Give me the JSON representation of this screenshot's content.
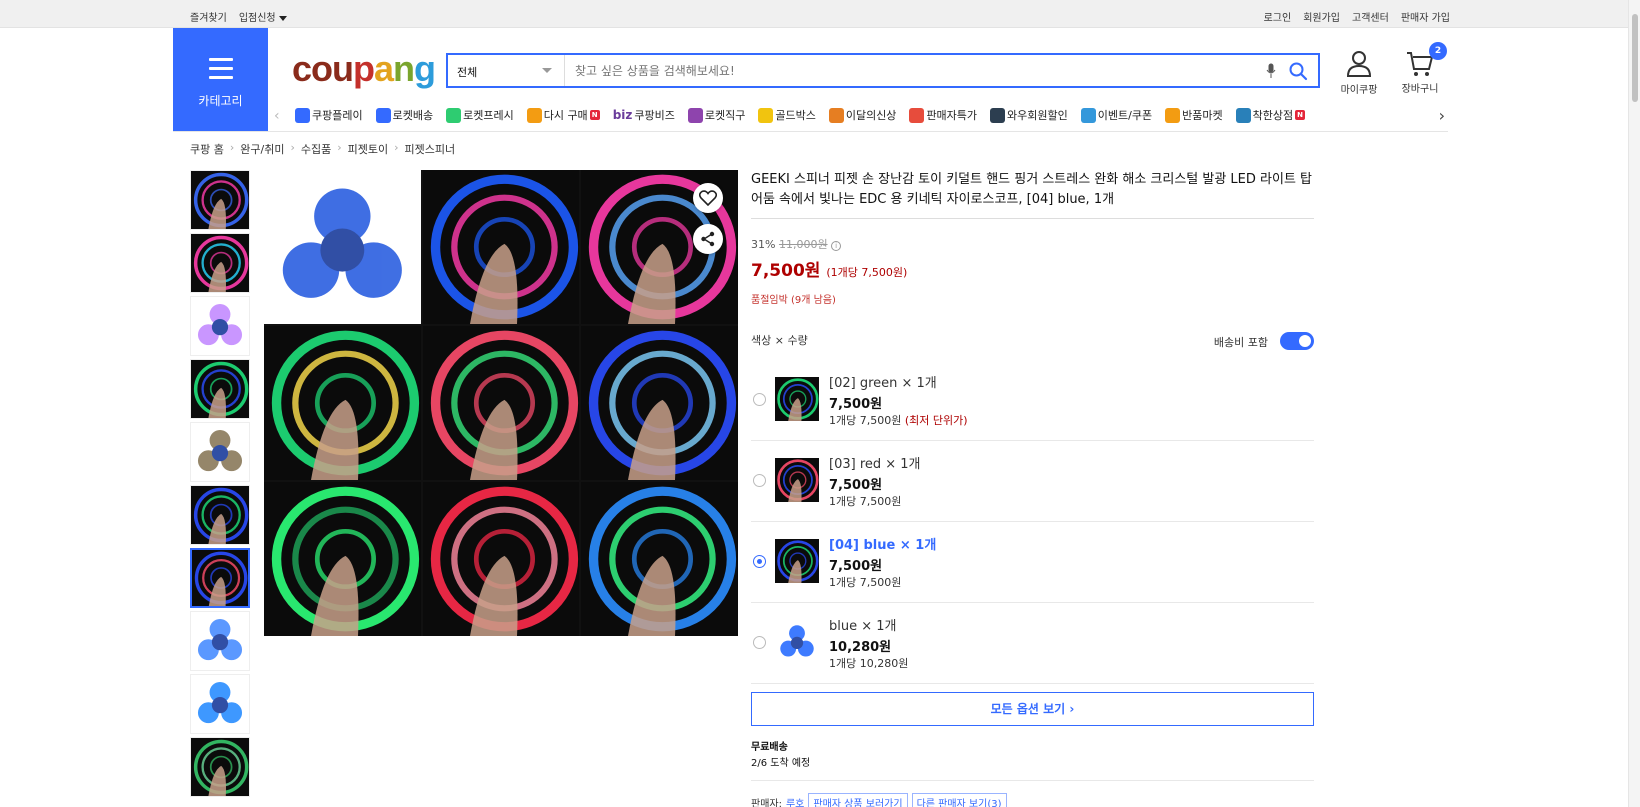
{
  "topbar": {
    "left": [
      "즐겨찾기",
      "입점신청"
    ],
    "right": [
      "로그인",
      "회원가입",
      "고객센터",
      "판매자 가입"
    ]
  },
  "category_label": "카테고리",
  "logo": {
    "text": [
      "cou",
      "p",
      "a",
      "n",
      "g"
    ]
  },
  "search": {
    "category": "전체",
    "placeholder": "찾고 싶은 상품을 검색해보세요!"
  },
  "header": {
    "my": "마이쿠팡",
    "cart": "장바구니",
    "cart_count": "2"
  },
  "nav": [
    {
      "label": "쿠팡플레이",
      "color": "#346aff",
      "icon": "play-icon"
    },
    {
      "label": "로켓배송",
      "color": "#346aff",
      "icon": "rocket-icon"
    },
    {
      "label": "로켓프레시",
      "color": "#2ecc71",
      "icon": "rocket-fresh-icon"
    },
    {
      "label": "다시 구매",
      "color": "#f39c12",
      "icon": "rebuy-icon",
      "badge": "N"
    },
    {
      "label": "쿠팡비즈",
      "color": "#6a3c9b",
      "icon": "biz-icon",
      "prefix": "biz"
    },
    {
      "label": "로켓직구",
      "color": "#8e44ad",
      "icon": "global-icon"
    },
    {
      "label": "골드박스",
      "color": "#f1c40f",
      "icon": "goldbox-icon"
    },
    {
      "label": "이달의신상",
      "color": "#e67e22",
      "icon": "new-icon"
    },
    {
      "label": "판매자특가",
      "color": "#e74c3c",
      "icon": "sale-icon"
    },
    {
      "label": "와우회원할인",
      "color": "#2c3e50",
      "icon": "wow-icon"
    },
    {
      "label": "이벤트/쿠폰",
      "color": "#3498db",
      "icon": "coupon-icon"
    },
    {
      "label": "반품마켓",
      "color": "#f39c12",
      "icon": "return-icon"
    },
    {
      "label": "착한상점",
      "color": "#2980b9",
      "icon": "store-icon",
      "badge": "N"
    }
  ],
  "breadcrumb": [
    "쿠팡 홈",
    "완구/취미",
    "수집품",
    "피젯토이",
    "피젯스피너"
  ],
  "product": {
    "title": "GEEKI 스피너 피젯 손 장난감 토이 키덜트 핸드 핑거 스트레스 완화 해소 크리스털 발광 LED 라이트 탑 어둠 속에서 빛나는 EDC 용 키네틱 자이로스코프, [04] blue, 1개",
    "discount": "31%",
    "original_price": "11,000원",
    "price": "7,500원",
    "unit_price": "(1개당 7,500원)",
    "stock": "품절임박 (9개 남음)",
    "option_header": "색상 × 수량",
    "shipping_toggle": "배송비 포함",
    "options": [
      {
        "name": "[02] green × 1개",
        "price": "7,500원",
        "per": "1개당 7,500원",
        "low": "(최저 단위가)",
        "selected": false
      },
      {
        "name": "[03] red × 1개",
        "price": "7,500원",
        "per": "1개당 7,500원",
        "low": "",
        "selected": false
      },
      {
        "name": "[04] blue × 1개",
        "price": "7,500원",
        "per": "1개당 7,500원",
        "low": "",
        "selected": true
      },
      {
        "name": "blue × 1개",
        "price": "10,280원",
        "per": "1개당 10,280원",
        "low": "",
        "selected": false
      }
    ],
    "all_options": "모든 옵션 보기 ›",
    "shipping_title": "무료배송",
    "shipping_eta": "2/6 도착 예정",
    "seller_label": "판매자:",
    "seller_name": "루호",
    "seller_products": "판매자 상품 보러가기",
    "other_sellers": "다른 판매자 보기(3)"
  },
  "colors": {
    "accent": "#346aff",
    "price": "#ae0000"
  }
}
